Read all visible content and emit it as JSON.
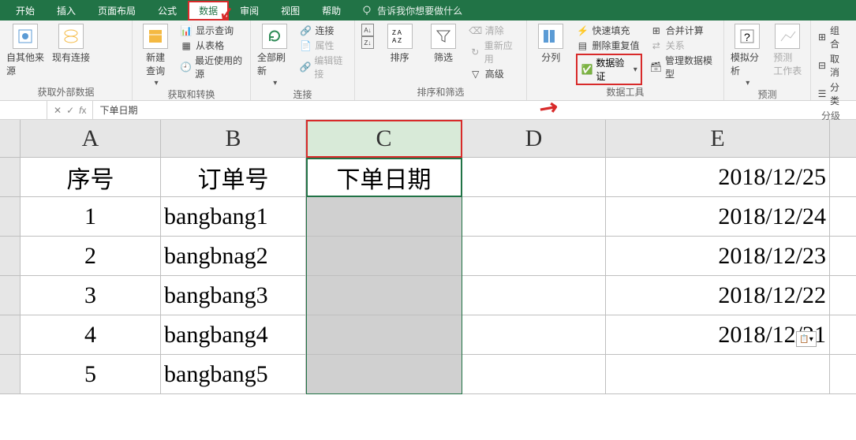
{
  "tabs": {
    "start": "开始",
    "insert": "插入",
    "page_layout": "页面布局",
    "formulas": "公式",
    "data": "数据",
    "review": "审阅",
    "view": "视图",
    "help": "帮助",
    "tellme": "告诉我你想要做什么"
  },
  "ribbon": {
    "from_other": "自其他来源",
    "existing_conn": "现有连接",
    "grp_external": "获取外部数据",
    "new_query": "新建\n查询",
    "show_query": "显示查询",
    "from_table": "从表格",
    "recent_sources": "最近使用的源",
    "grp_transform": "获取和转换",
    "refresh_all": "全部刷新",
    "connections": "连接",
    "properties": "属性",
    "edit_links": "编辑链接",
    "grp_conn": "连接",
    "sort_asc_icon": "A↓Z",
    "sort_desc_icon": "Z↓A",
    "sort": "排序",
    "filter": "筛选",
    "clear": "清除",
    "reapply": "重新应用",
    "advanced": "高级",
    "grp_sortfilter": "排序和筛选",
    "text_to_cols": "分列",
    "flash_fill": "快速填充",
    "remove_dup": "删除重复值",
    "data_validation": "数据验证",
    "consolidate": "合并计算",
    "relationships": "关系",
    "manage_model": "管理数据模型",
    "grp_datatools": "数据工具",
    "whatif": "模拟分析",
    "forecast": "预测\n工作表",
    "grp_forecast": "预测",
    "group": "组合",
    "ungroup": "取消",
    "subtotal": "分类",
    "grp_outline": "分级"
  },
  "formula_bar": {
    "value": "下单日期"
  },
  "columns": {
    "A": "A",
    "B": "B",
    "C": "C",
    "D": "D",
    "E": "E"
  },
  "headers": {
    "A": "序号",
    "B": "订单号",
    "C": "下单日期"
  },
  "rows": [
    {
      "n": "1",
      "a": "1",
      "b": "bangbang1",
      "e": "2018/12/25"
    },
    {
      "n": "2",
      "a": "2",
      "b": "bangbnag2",
      "e": "2018/12/24"
    },
    {
      "n": "3",
      "a": "3",
      "b": "bangbang3",
      "e": "2018/12/23"
    },
    {
      "n": "4",
      "a": "4",
      "b": "bangbang4",
      "e": "2018/12/22"
    },
    {
      "n": "5",
      "a": "5",
      "b": "bangbang5",
      "e": "2018/12/21"
    }
  ],
  "header_e_first": "2018/12/25"
}
